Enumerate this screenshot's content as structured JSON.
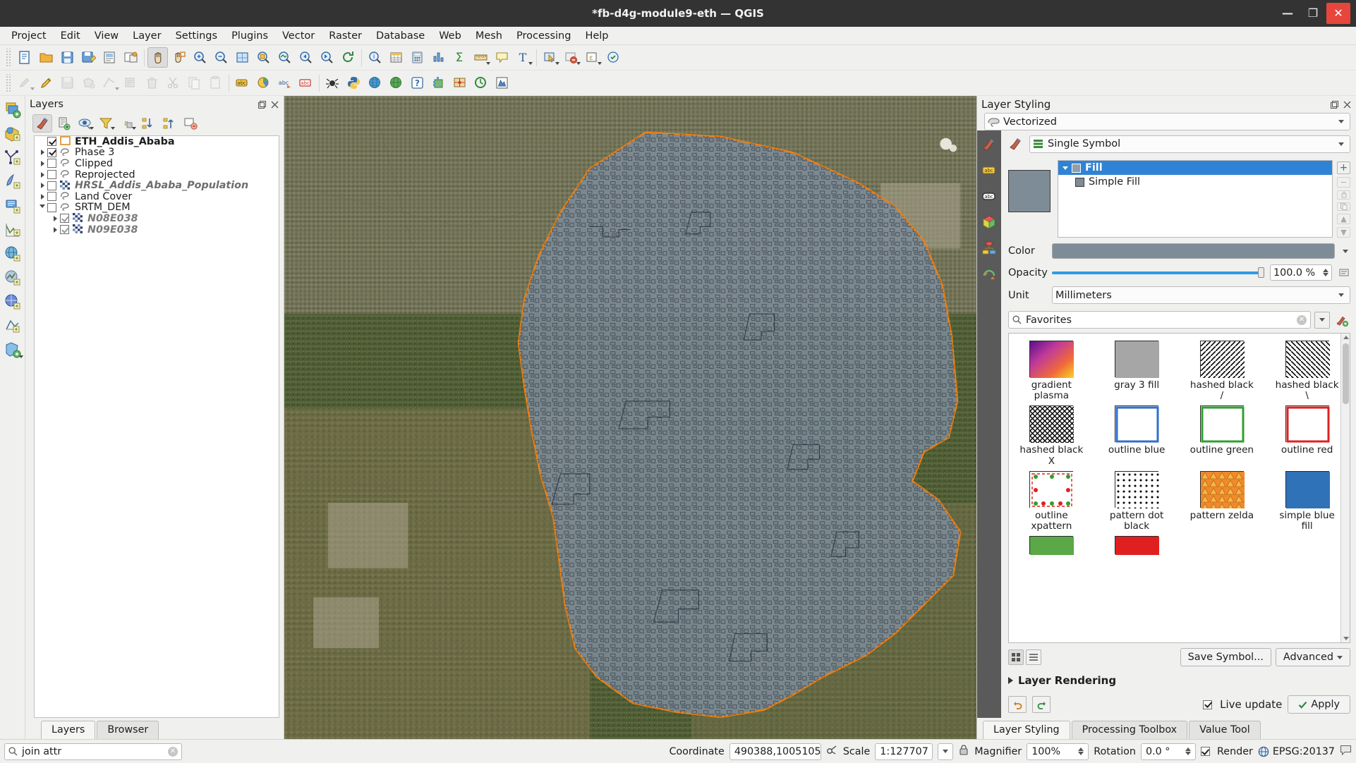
{
  "window": {
    "title": "*fb-d4g-module9-eth — QGIS",
    "minimize": "—",
    "maximize": "❐",
    "close": "✕"
  },
  "menubar": [
    "Project",
    "Edit",
    "View",
    "Layer",
    "Settings",
    "Plugins",
    "Vector",
    "Raster",
    "Database",
    "Web",
    "Mesh",
    "Processing",
    "Help"
  ],
  "layers_panel": {
    "title": "Layers",
    "toolbar_icons": [
      "open-layer-styling-panel-icon",
      "add-group-icon",
      "manage-visibility-icon",
      "filter-legend-icon",
      "expression-filter-icon",
      "expand-all-icon",
      "collapse-all-icon",
      "remove-layer-icon"
    ],
    "items": [
      {
        "name": "ETH_Addis_Ababa",
        "checked": true,
        "expander": false,
        "style": "bold",
        "icon": "polygon-outline-icon",
        "indent": 0
      },
      {
        "name": "Phase 3",
        "checked": true,
        "expander": "closed",
        "style": "normal",
        "icon": "vector-layer-icon",
        "indent": 0
      },
      {
        "name": "Clipped",
        "checked": false,
        "expander": "closed",
        "style": "normal",
        "icon": "vector-layer-icon",
        "indent": 0
      },
      {
        "name": "Reprojected",
        "checked": false,
        "expander": "closed",
        "style": "normal",
        "icon": "vector-layer-icon",
        "indent": 0
      },
      {
        "name": "HRSL_Addis_Ababa_Population",
        "checked": false,
        "expander": "closed",
        "style": "italic",
        "icon": "raster-layer-icon",
        "indent": 0
      },
      {
        "name": "Land Cover",
        "checked": false,
        "expander": "closed",
        "style": "normal",
        "icon": "vector-layer-icon",
        "indent": 0
      },
      {
        "name": "SRTM_DEM",
        "checked": false,
        "expander": "open",
        "style": "normal",
        "icon": "vector-layer-icon",
        "indent": 0
      },
      {
        "name": "N08E038",
        "checked": true,
        "expander": "closed",
        "style": "italic-dim",
        "icon": "raster-layer-icon",
        "indent": 1
      },
      {
        "name": "N09E038",
        "checked": true,
        "expander": "closed",
        "style": "italic-dim",
        "icon": "raster-layer-icon",
        "indent": 1
      }
    ],
    "tabs": [
      {
        "label": "Layers",
        "selected": true
      },
      {
        "label": "Browser",
        "selected": false
      }
    ]
  },
  "styling_panel": {
    "title": "Layer Styling",
    "layer_selector": "Vectorized",
    "renderer": "Single Symbol",
    "symbol_tree": [
      {
        "label": "Fill",
        "selected": true,
        "level": 0
      },
      {
        "label": "Simple Fill",
        "selected": false,
        "level": 1
      }
    ],
    "properties": {
      "color_label": "Color",
      "color_value": "#7d8c97",
      "opacity_label": "Opacity",
      "opacity_value": "100.0 %",
      "unit_label": "Unit",
      "unit_value": "Millimeters"
    },
    "search": {
      "value": "Favorites",
      "placeholder": "Favorites"
    },
    "symbol_library": [
      {
        "label": "gradient plasma",
        "kind": "gradient"
      },
      {
        "label": "gray 3 fill",
        "kind": "gray"
      },
      {
        "label": "hashed black /",
        "kind": "hatch-fwd"
      },
      {
        "label": "hashed black \\",
        "kind": "hatch-back"
      },
      {
        "label": "hashed black X",
        "kind": "hatch-x"
      },
      {
        "label": "outline blue",
        "kind": "outline-blue"
      },
      {
        "label": "outline green",
        "kind": "outline-green"
      },
      {
        "label": "outline red",
        "kind": "outline-red"
      },
      {
        "label": "outline xpattern",
        "kind": "xpattern"
      },
      {
        "label": "pattern dot black",
        "kind": "dot"
      },
      {
        "label": "pattern zelda",
        "kind": "zelda"
      },
      {
        "label": "simple blue fill",
        "kind": "blue"
      },
      {
        "label": "",
        "kind": "green-partial"
      },
      {
        "label": "",
        "kind": "red-partial"
      }
    ],
    "footer": {
      "save_symbol": "Save Symbol...",
      "advanced": "Advanced",
      "layer_rendering": "Layer Rendering",
      "live_update": "Live update",
      "live_update_checked": true,
      "apply": "Apply",
      "undo_icon": "undo-icon",
      "redo_icon": "redo-icon"
    },
    "tabs": [
      {
        "label": "Layer Styling",
        "selected": true
      },
      {
        "label": "Processing Toolbox",
        "selected": false
      },
      {
        "label": "Value Tool",
        "selected": false
      }
    ]
  },
  "statusbar": {
    "locator_value": "join attr",
    "coordinate_label": "Coordinate",
    "coordinate_value": "490388,1005105",
    "scale_label": "Scale",
    "scale_value": "1:127707",
    "magnifier_label": "Magnifier",
    "magnifier_value": "100%",
    "rotation_label": "Rotation",
    "rotation_value": "0.0 °",
    "render_label": "Render",
    "render_checked": true,
    "crs_value": "EPSG:20137",
    "lock_icon": "lock-icon",
    "globe_icon": "globe-icon"
  },
  "colors": {
    "accent_blue": "#3083d4",
    "selection_orange": "#f08010",
    "polygon_fill": "#7d8c97",
    "titlebar": "#333333",
    "panel_bg": "#f0f0ef"
  }
}
